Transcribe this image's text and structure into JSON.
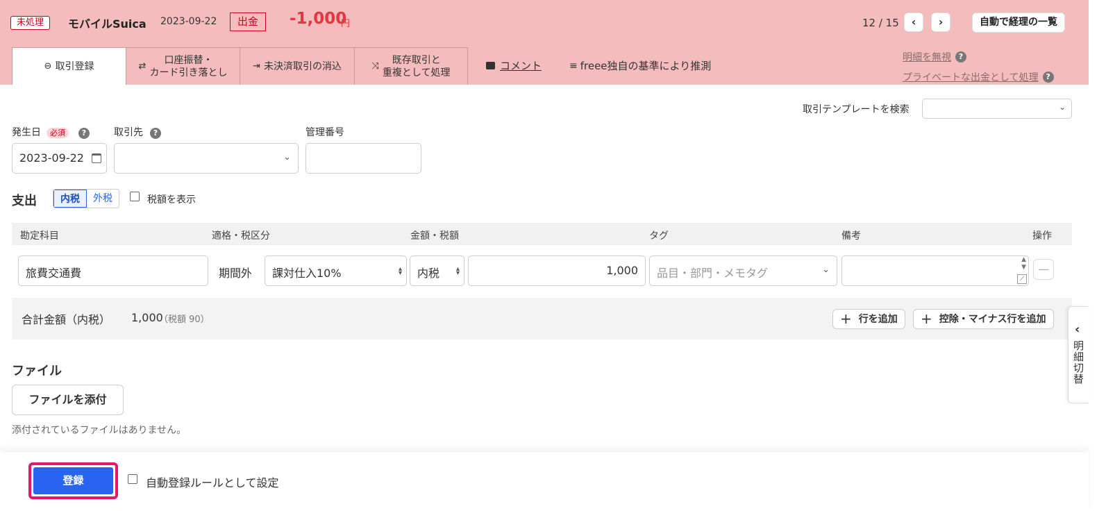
{
  "header": {
    "status_badge": "未処理",
    "account_name": "モバイルSuica",
    "date": "2023-09-22",
    "direction_badge": "出金",
    "amount": "-1,000",
    "amount_unit": "円",
    "pager": "12 / 15",
    "prev_icon": "chevron-left",
    "next_icon": "chevron-right",
    "list_button": "自動で経理の一覧"
  },
  "tabs": [
    {
      "label": "取引登録",
      "icon": "minus-circle",
      "active": true
    },
    {
      "label_line1": "口座振替・",
      "label_line2": "カード引き落とし",
      "icon": "swap-arrows"
    },
    {
      "label": "未決済取引の消込",
      "icon": "merge-arrows"
    },
    {
      "label_line1": "既存取引と",
      "label_line2": "重複として処理",
      "icon": "split-arrows"
    }
  ],
  "header_links": {
    "comment": "コメント",
    "estimate": "freee独自の基準により推測",
    "ignore": "明細を無視",
    "private": "プライベートな出金として処理"
  },
  "template_search_label": "取引テンプレートを検索",
  "form": {
    "date_label": "発生日",
    "required_badge": "必須",
    "date_value": "2023-09-22",
    "partner_label": "取引先",
    "mgmt_label": "管理番号"
  },
  "expense": {
    "title": "支出",
    "tax_in": "内税",
    "tax_out": "外税",
    "show_tax_label": "税額を表示"
  },
  "table": {
    "headers": [
      "勘定科目",
      "適格・税区分",
      "金額・税額",
      "タグ",
      "備考",
      "操作"
    ],
    "row": {
      "account": "旅費交通費",
      "qualified": "期間外",
      "tax_category": "課対仕入10%",
      "tax_mode": "内税",
      "amount": "1,000",
      "tag_placeholder": "品目・部門・メモタグ"
    }
  },
  "total": {
    "label": "合計金額（内税）",
    "amount": "1,000",
    "tax_note": "（税額 90）",
    "add_row": "行を追加",
    "add_deduction_row": "控除・マイナス行を追加"
  },
  "side_tab": {
    "chars": [
      "明",
      "細",
      "切",
      "替"
    ]
  },
  "file": {
    "title": "ファイル",
    "attach_button": "ファイルを添付",
    "none_text": "添付されているファイルはありません。"
  },
  "footer": {
    "register_button": "登録",
    "auto_rule_label": "自動登録ルールとして設定"
  },
  "colors": {
    "header_bg": "#f5bcbd",
    "accent_red": "#e2373f",
    "primary_blue": "#2864f0",
    "highlight_pink": "#e6176b"
  }
}
